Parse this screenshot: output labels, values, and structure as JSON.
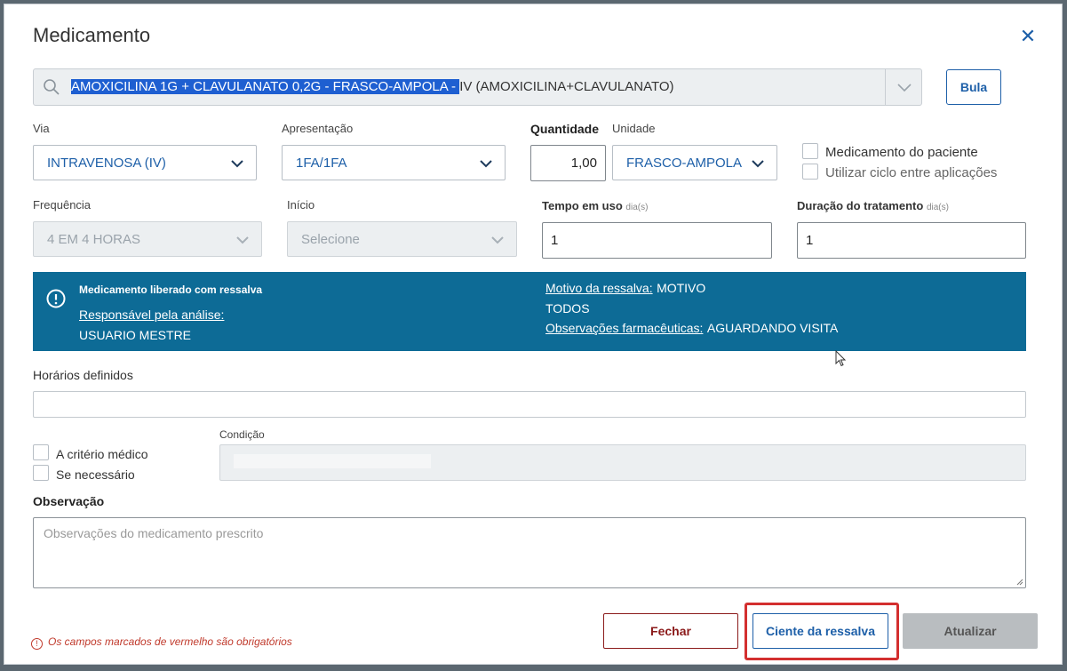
{
  "modal": {
    "title": "Medicamento",
    "close_icon": "close-icon"
  },
  "search": {
    "highlighted_text": "AMOXICILINA 1G + CLAVULANATO 0,2G - FRASCO-AMPOLA - ",
    "rest_text": "IV (AMOXICILINA+CLAVULANATO)"
  },
  "bula_button": "Bula",
  "fields": {
    "via": {
      "label": "Via",
      "value": "INTRAVENOSA (IV)"
    },
    "apresentacao": {
      "label": "Apresentação",
      "value": "1FA/1FA"
    },
    "quantidade": {
      "label": "Quantidade",
      "value": "1,00"
    },
    "unidade": {
      "label": "Unidade",
      "value": "FRASCO-AMPOLA"
    },
    "frequencia": {
      "label": "Frequência",
      "value": "4 EM 4 HORAS"
    },
    "inicio": {
      "label": "Início",
      "value": "Selecione"
    },
    "tempo_em_uso": {
      "label": "Tempo em uso",
      "hint": "dia(s)",
      "value": "1"
    },
    "duracao": {
      "label": "Duração do tratamento",
      "hint": "dia(s)",
      "value": "1"
    }
  },
  "checkboxes": {
    "medicamento_paciente": "Medicamento do paciente",
    "utilizar_ciclo": "Utilizar ciclo entre aplicações",
    "criterio_medico": "A critério médico",
    "se_necessario": "Se necessário"
  },
  "alert": {
    "title": "Medicamento liberado com ressalva",
    "responsavel_label": "Responsável pela análise:",
    "responsavel_value": "USUARIO MESTRE",
    "motivo_label": "Motivo da ressalva:",
    "motivo_value": "MOTIVO",
    "motivo_line2": "TODOS",
    "obs_label": "Observações farmacêuticas:",
    "obs_value": "AGUARDANDO VISITA"
  },
  "horarios_label": "Horários definidos",
  "condicao_label": "Condição",
  "observacao": {
    "label": "Observação",
    "placeholder": "Observações do medicamento prescrito"
  },
  "footer": {
    "required_note": "Os campos marcados de vermelho são obrigatórios",
    "fechar": "Fechar",
    "ciente": "Ciente da ressalva",
    "atualizar": "Atualizar"
  },
  "colors": {
    "accent": "#1d5fa8",
    "alert_bg": "#0d6b96",
    "danger": "#8b1a1a",
    "highlight_frame": "#d32f2f"
  }
}
